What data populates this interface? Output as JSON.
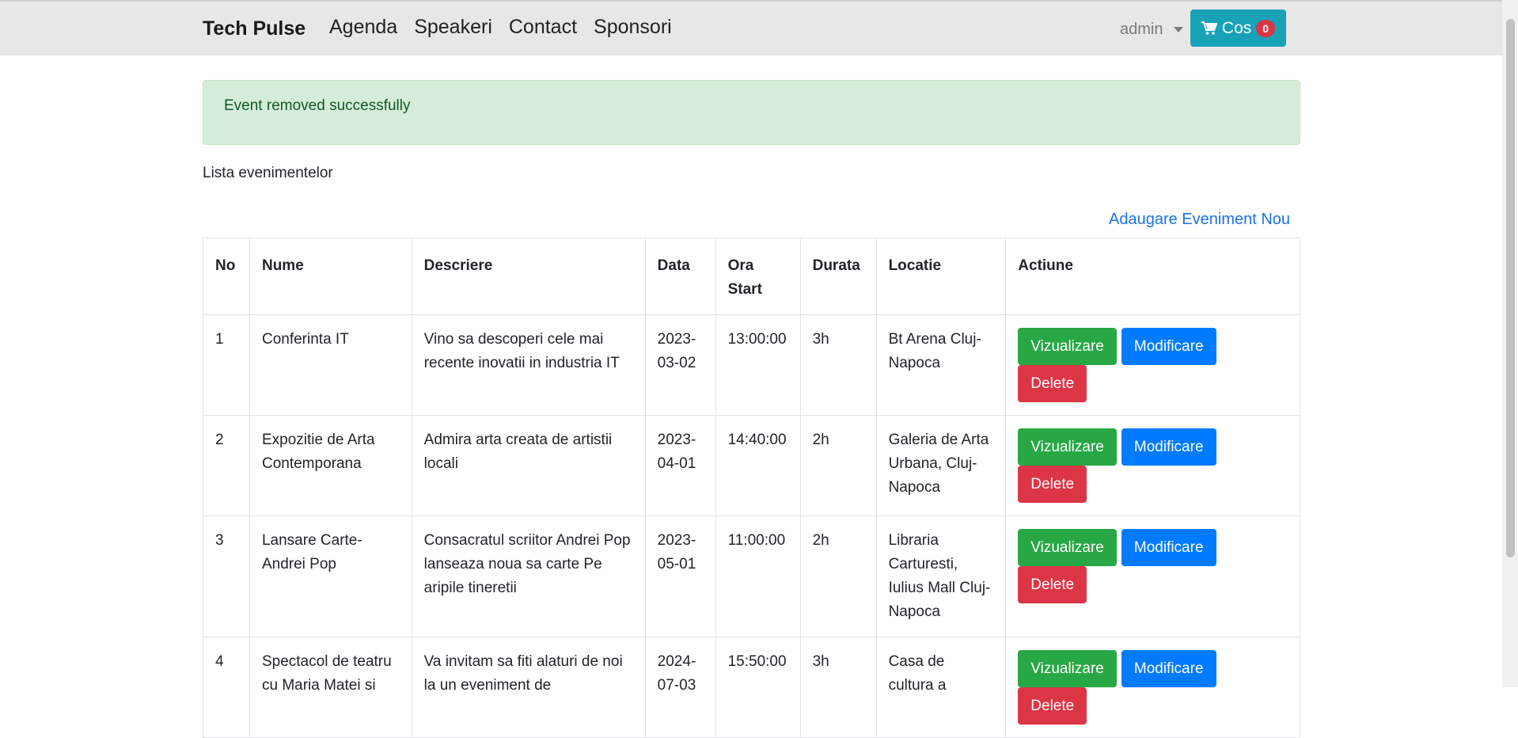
{
  "navbar": {
    "brand": "Tech Pulse",
    "links": [
      "Agenda",
      "Speakeri",
      "Contact",
      "Sponsori"
    ],
    "user": "admin",
    "cart_label": "Cos",
    "cart_count": "0"
  },
  "alert": {
    "message": "Event removed successfully"
  },
  "page": {
    "list_title": "Lista evenimentelor",
    "add_link": "Adaugare Eveniment Nou"
  },
  "table": {
    "headers": [
      "No",
      "Nume",
      "Descriere",
      "Data",
      "Ora Start",
      "Durata",
      "Locatie",
      "Actiune"
    ],
    "rows": [
      {
        "no": "1",
        "nume": "Conferinta IT",
        "descriere": "Vino sa descoperi cele mai recente inovatii in industria IT",
        "data": "2023-03-02",
        "ora": "13:00:00",
        "durata": "3h",
        "locatie": "Bt Arena Cluj-Napoca"
      },
      {
        "no": "2",
        "nume": "Expozitie de Arta Contemporana",
        "descriere": "Admira arta creata de artistii locali",
        "data": "2023-04-01",
        "ora": "14:40:00",
        "durata": "2h",
        "locatie": "Galeria de Arta Urbana, Cluj-Napoca"
      },
      {
        "no": "3",
        "nume": "Lansare Carte-Andrei Pop",
        "descriere": "Consacratul scriitor Andrei Pop lanseaza noua sa carte Pe aripile tineretii",
        "data": "2023-05-01",
        "ora": "11:00:00",
        "durata": "2h",
        "locatie": "Libraria Carturesti, Iulius Mall Cluj-Napoca"
      },
      {
        "no": "4",
        "nume": "Spectacol de teatru cu Maria Matei si",
        "descriere": "Va invitam sa fiti alaturi de noi la un eveniment de",
        "data": "2024-07-03",
        "ora": "15:50:00",
        "durata": "3h",
        "locatie": "Casa de cultura a"
      }
    ],
    "actions": {
      "view": "Vizualizare",
      "edit": "Modificare",
      "delete": "Delete"
    }
  },
  "colors": {
    "navbar_bg": "#e7e7e7",
    "cart_bg": "#17a2b8",
    "badge_bg": "#dc3545",
    "alert_bg": "#d4edda",
    "alert_text": "#155724",
    "link": "#1a73e8",
    "view_btn": "#28a745",
    "edit_btn": "#007bff",
    "delete_btn": "#dc3545"
  }
}
